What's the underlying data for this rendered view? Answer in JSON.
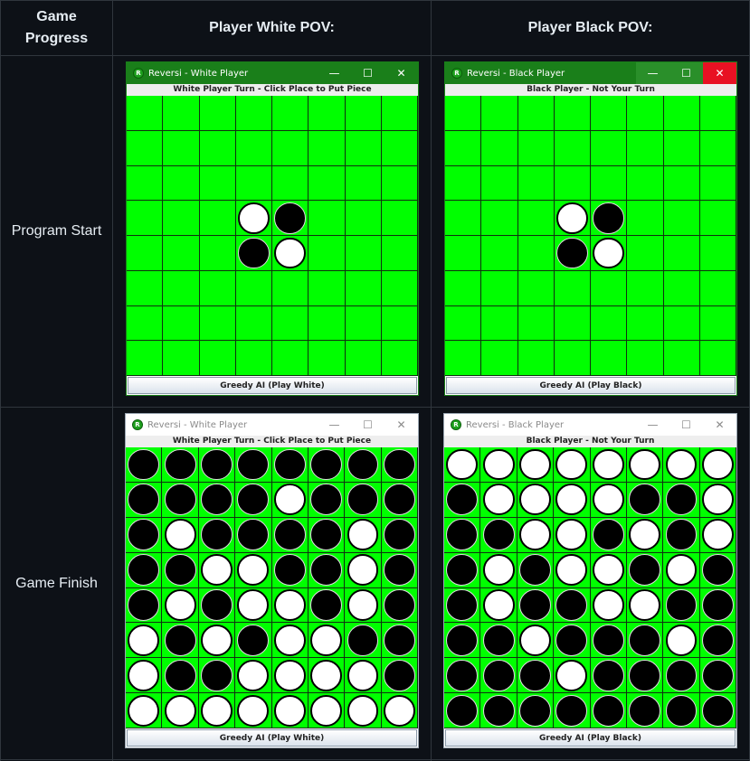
{
  "headers": {
    "col1": "Game\nProgress",
    "col2": "Player White POV:",
    "col3": "Player Black POV:"
  },
  "rows": {
    "start": "Program Start",
    "finish": "Game Finish"
  },
  "windows": {
    "start_white": {
      "title": "Reversi - White Player",
      "status": "White Player Turn - Click Place to Put Piece",
      "button": "Greedy AI (Play White)",
      "active": true,
      "board": [
        "........",
        "........",
        "........",
        "...WB...",
        "...BW...",
        "........",
        "........",
        "........"
      ]
    },
    "start_black": {
      "title": "Reversi - Black Player",
      "status": "Black Player - Not Your Turn",
      "button": "Greedy AI (Play Black)",
      "active": true,
      "board": [
        "........",
        "........",
        "........",
        "...WB...",
        "...BW...",
        "........",
        "........",
        "........"
      ]
    },
    "finish_white": {
      "title": "Reversi - White Player",
      "status": "White Player Turn - Click Place to Put Piece",
      "button": "Greedy AI (Play White)",
      "active": false,
      "board": [
        "BBBBBBBB",
        "BBBBWBBB",
        "BWBBBBWB",
        "BBWWBBWB",
        "BWBWWBWB",
        "WBWBWWBB",
        "WBBWWWWB",
        "WWWWWWWW"
      ]
    },
    "finish_black": {
      "title": "Reversi - Black Player",
      "status": "Black Player - Not Your Turn",
      "button": "Greedy AI (Play Black)",
      "active": false,
      "board": [
        "WWWWWWWW",
        "BWWWWBBW",
        "BBWWBWBW",
        "BWBWWBWB",
        "BWBBWWBB",
        "BBWBBBWB",
        "BBBWBBBB",
        "BBBBBBBB"
      ]
    }
  },
  "controls": {
    "minimize": "—",
    "maximize": "☐",
    "close": "✕"
  },
  "colors": {
    "board_green": "#00ff00",
    "titlebar_active_green": "#1a7f1a",
    "close_red": "#e81123",
    "page_bg": "#0d1117"
  }
}
